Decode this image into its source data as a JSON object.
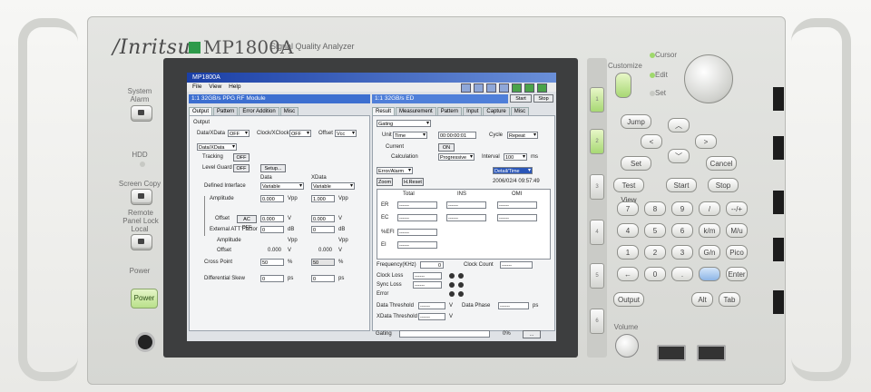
{
  "device": {
    "brand": "/Inritsu",
    "model": "MP1800A",
    "subtitle": "Signal Quality Analyzer",
    "left_panel": {
      "system_alarm": "System Alarm",
      "hdd": "HDD",
      "screen_copy": "Screen Copy",
      "remote_panel_lock": "Remote Panel Lock",
      "local": "Local",
      "power_label": "Power",
      "power_button": "Power"
    },
    "right_panel": {
      "cursor": "Cursor",
      "edit": "Edit",
      "set": "Set",
      "customize": "Customize",
      "jump": "Jump",
      "set_key": "Set",
      "cancel": "Cancel",
      "test_view": "Test View",
      "start": "Start",
      "stop": "Stop",
      "numpad": [
        "7",
        "8",
        "9",
        "/",
        "--/+",
        "4",
        "5",
        "6",
        "k/m",
        "M/u",
        "1",
        "2",
        "3",
        "G/n",
        "Pico",
        "←",
        "0",
        ".",
        "",
        "Enter"
      ],
      "output": "Output",
      "alt": "Alt",
      "tab": "Tab",
      "volume": "Volume",
      "softkeys": [
        "1",
        "2",
        "3",
        "4",
        "5",
        "6"
      ]
    }
  },
  "screen": {
    "title": "MP1800A",
    "menu": [
      "File",
      "View",
      "Help"
    ],
    "left_header": "1:1 32GB/s PPG RF Module",
    "right_header": "1:1 32GB/s ED",
    "start_btn": "Start",
    "stop_btn": "Stop",
    "left_tabs": [
      "Output",
      "Pattern",
      "Error Addition",
      "Misc"
    ],
    "right_tabs": [
      "Result",
      "Measurement",
      "Pattern",
      "Input",
      "Capture",
      "Misc"
    ],
    "output_group": "Output",
    "data_xdata": "Data/XData",
    "data_xdata_val": "OFF",
    "clock_xclock": "Clock/XClock",
    "clock_xclock_val": "OFF",
    "offset": "Offset",
    "offset_val": "Vcc",
    "data_sel": "Data/XData",
    "tracking": "Tracking",
    "tracking_val": "OFF",
    "level_guard": "Level Guard",
    "level_guard_val": "OFF",
    "setup": "Setup...",
    "col_data": "Data",
    "col_xdata": "XData",
    "defined_interface": "Defined Interface",
    "variable1": "Variable",
    "variable2": "Variable",
    "amplitude": "Amplitude",
    "amp_val1": "0.000",
    "amp_val2": "1.000",
    "vpp": "Vpp",
    "offset2": "Offset",
    "ac_off": "AC OFF",
    "off_val1": "0.000",
    "off_val2": "0.000",
    "v": "V",
    "ext_att": "External ATT Factor",
    "att1": "0",
    "att2": "0",
    "db": "dB",
    "amplitude2": "Amplitude",
    "offset3": "Offset",
    "off_read1": "0.000",
    "off_read2": "0.000",
    "cross_point": "Cross Point",
    "cross1": "50",
    "cross2": "50",
    "pct": "%",
    "diff_skew": "Differential Skew",
    "skew1": "0",
    "skew2": "0",
    "ps": "ps",
    "gating": "Gating",
    "unit": "Unit",
    "unit_val": "Time",
    "time_val": "00:00:00:01",
    "cycle": "Cycle",
    "cycle_val": "Repeat",
    "current": "Current",
    "current_val": "ON",
    "calculation": "Calculation",
    "calc_val": "Progressive",
    "interval": "Interval",
    "interval_val": "100",
    "ms": "ms",
    "error_alarm": "Error/Alarm",
    "detail_time": "Detail/Time",
    "zoom": "Zoom",
    "hreset": "H.Reset",
    "timestamp": "2006/02/4 09:57:49",
    "res_cols": [
      "Total",
      "INS",
      "OMI"
    ],
    "res_rows": [
      "ER",
      "EC",
      "%EFI",
      "EI"
    ],
    "dash": "------",
    "frequency": "Frequency(KHz)",
    "freq_val": "0",
    "clock_count": "Clock Count",
    "clock_loss": "Clock Loss",
    "sync_loss": "Sync Loss",
    "error": "Error",
    "data_threshold": "Data Threshold",
    "data_phase": "Data Phase",
    "xdata_threshold": "XData Threshold",
    "status_left": "Gating",
    "status_right": "0%"
  },
  "colors": {
    "accent_green": "#2d9a4a",
    "titlebar": "#1b3fa6",
    "ppg_header": "#3d6fd0",
    "ed_header": "#4f7fd9"
  }
}
